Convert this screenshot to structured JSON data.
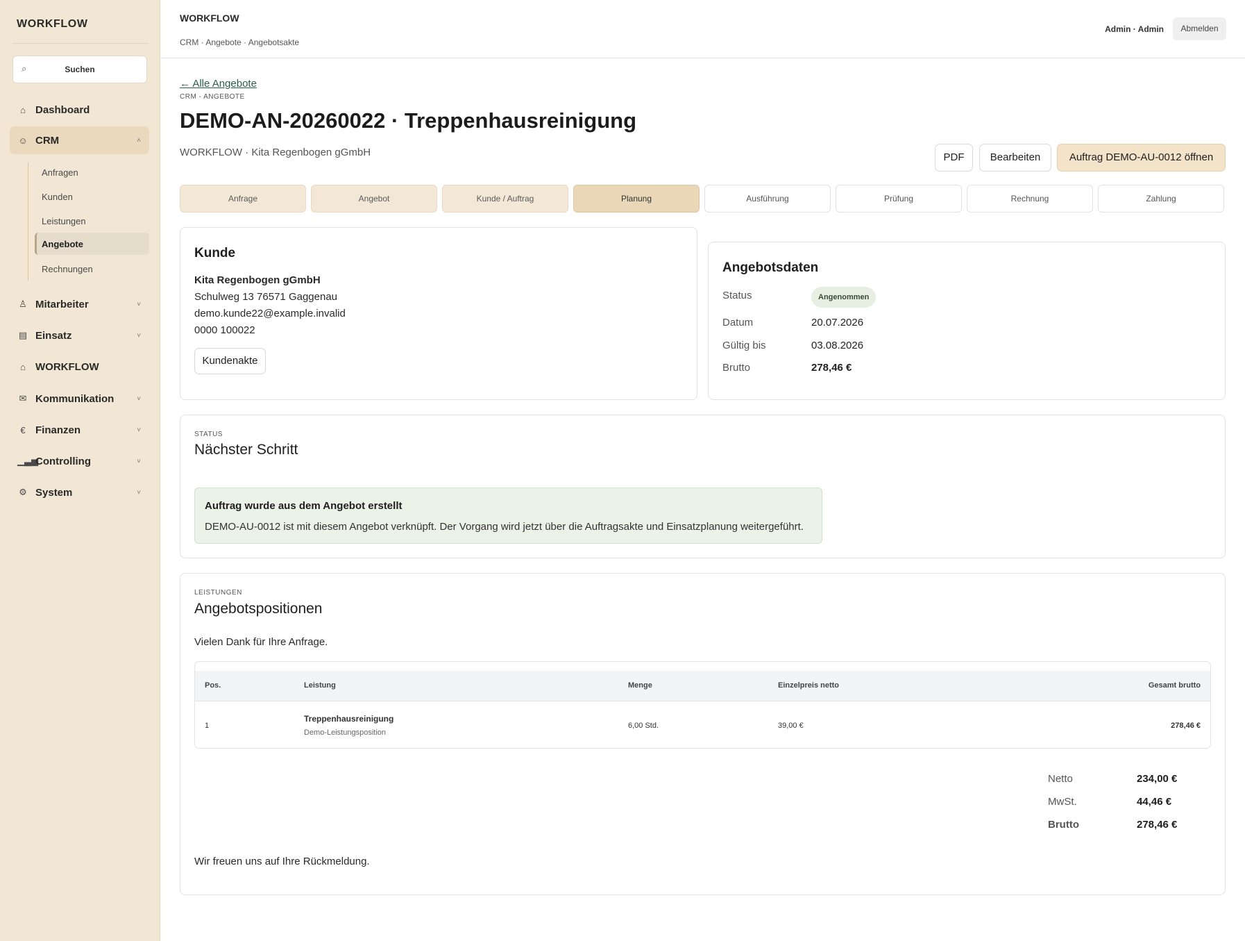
{
  "sidebar": {
    "brand": "WORKFLOW",
    "search_label": "Suchen",
    "items": [
      {
        "label": "Dashboard",
        "icon": "home-icon"
      },
      {
        "label": "CRM",
        "icon": "users-icon"
      },
      {
        "label": "Mitarbeiter",
        "icon": "user-icon"
      },
      {
        "label": "Einsatz",
        "icon": "calendar-icon"
      },
      {
        "label": "WORKFLOW",
        "icon": "home-icon"
      },
      {
        "label": "Kommunikation",
        "icon": "mail-icon"
      },
      {
        "label": "Finanzen",
        "icon": "euro-icon"
      },
      {
        "label": "Controlling",
        "icon": "bar-chart-icon"
      },
      {
        "label": "System",
        "icon": "gear-icon"
      }
    ],
    "crm_sub": [
      "Anfragen",
      "Kunden",
      "Leistungen",
      "Angebote",
      "Rechnungen"
    ]
  },
  "topbar": {
    "title": "WORKFLOW",
    "breadcrumb": "CRM · Angebote · Angebotsakte",
    "user": "Admin · Admin",
    "logout": "Abmelden"
  },
  "header": {
    "back": "← Alle Angebote",
    "eyebrow": "CRM - ANGEBOTE",
    "title": "DEMO-AN-20260022 · Treppenhausreinigung",
    "subtitle": "WORKFLOW · Kita Regenbogen gGmbH",
    "btn_pdf": "PDF",
    "btn_edit": "Bearbeiten",
    "btn_order": "Auftrag DEMO-AU-0012 öffnen"
  },
  "steps": [
    "Anfrage",
    "Angebot",
    "Kunde / Auftrag",
    "Planung",
    "Ausführung",
    "Prüfung",
    "Rechnung",
    "Zahlung"
  ],
  "customer": {
    "heading": "Kunde",
    "name": "Kita Regenbogen gGmbH",
    "address": "Schulweg 13 76571 Gaggenau",
    "email": "demo.kunde22@example.invalid",
    "phone": "0000 100022",
    "button": "Kundenakte"
  },
  "offer": {
    "heading": "Angebotsdaten",
    "status_label": "Status",
    "status": "Angenommen",
    "date_label": "Datum",
    "date": "20.07.2026",
    "valid_label": "Gültig bis",
    "valid": "03.08.2026",
    "gross_label": "Brutto",
    "gross": "278,46 €"
  },
  "next_step": {
    "eyebrow": "STATUS",
    "heading": "Nächster Schritt",
    "notice_title": "Auftrag wurde aus dem Angebot erstellt",
    "notice_text": "DEMO-AU-0012 ist mit diesem Angebot verknüpft. Der Vorgang wird jetzt über die Auftragsakte und Einsatzplanung weitergeführt."
  },
  "positions": {
    "eyebrow": "LEISTUNGEN",
    "heading": "Angebotspositionen",
    "intro": "Vielen Dank für Ihre Anfrage.",
    "columns": [
      "Pos.",
      "Leistung",
      "Menge",
      "Einzelpreis netto",
      "Gesamt brutto"
    ],
    "rows": [
      {
        "pos": "1",
        "name": "Treppenhausreinigung",
        "desc": "Demo-Leistungsposition",
        "qty": "6,00 Std.",
        "unit": "39,00 €",
        "total": "278,46 €"
      }
    ],
    "totals": [
      {
        "label": "Netto",
        "value": "234,00 €"
      },
      {
        "label": "MwSt.",
        "value": "44,46 €"
      },
      {
        "label": "Brutto",
        "value": "278,46 €"
      }
    ],
    "outro": "Wir freuen uns auf Ihre Rückmeldung."
  },
  "colors": {
    "sidebar_bg": "#f1e7d4",
    "accent": "#f2e3c9",
    "success_bg": "#ebf2e7",
    "link": "#2c5e4e"
  }
}
